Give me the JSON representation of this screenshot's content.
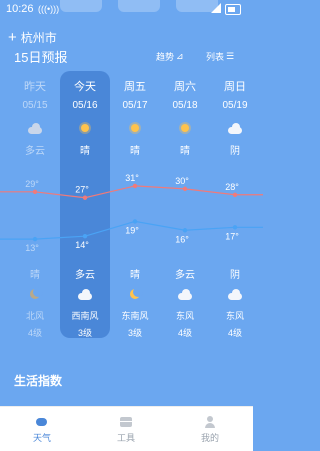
{
  "status_bar": {
    "time": "10:26",
    "wifi_text": "(((•)))"
  },
  "header": {
    "city": "杭州市",
    "forecast_title": "15日预报",
    "trend_label": "趋势",
    "list_label": "列表"
  },
  "days": [
    {
      "name": "昨天",
      "date": "05/15",
      "weather_day": "多云",
      "icon_day": "cloud-icon",
      "high": "29°",
      "low": "13°",
      "weather_night": "晴",
      "icon_night": "moon-icon",
      "wind_dir": "北风",
      "wind_level": "4级",
      "past": true
    },
    {
      "name": "今天",
      "date": "05/16",
      "weather_day": "晴",
      "icon_day": "sun-icon",
      "high": "27°",
      "low": "14°",
      "weather_night": "多云",
      "icon_night": "cloud-icon",
      "wind_dir": "西南风",
      "wind_level": "3级",
      "past": false
    },
    {
      "name": "周五",
      "date": "05/17",
      "weather_day": "晴",
      "icon_day": "sun-icon",
      "high": "31°",
      "low": "19°",
      "weather_night": "晴",
      "icon_night": "moon-icon",
      "wind_dir": "东南风",
      "wind_level": "3级",
      "past": false
    },
    {
      "name": "周六",
      "date": "05/18",
      "weather_day": "晴",
      "icon_day": "sun-icon",
      "high": "30°",
      "low": "16°",
      "weather_night": "多云",
      "icon_night": "cloud-icon",
      "wind_dir": "东风",
      "wind_level": "4级",
      "past": false
    },
    {
      "name": "周日",
      "date": "05/19",
      "weather_day": "阴",
      "icon_day": "cloud-icon",
      "high": "28°",
      "low": "17°",
      "weather_night": "阴",
      "icon_night": "cloud-icon",
      "wind_dir": "东风",
      "wind_level": "4级",
      "past": false
    }
  ],
  "chart_data": {
    "type": "line",
    "categories": [
      "05/15",
      "05/16",
      "05/17",
      "05/18",
      "05/19"
    ],
    "series": [
      {
        "values": [
          29,
          27,
          31,
          30,
          28
        ]
      },
      {
        "values": [
          13,
          14,
          19,
          16,
          17
        ]
      }
    ],
    "ylim": [
      10,
      33
    ]
  },
  "life_index_title": "生活指数",
  "bottom_nav": [
    {
      "label": "天气",
      "icon": "weather-icon",
      "active": true
    },
    {
      "label": "工具",
      "icon": "tools-icon",
      "active": false
    },
    {
      "label": "我的",
      "icon": "profile-icon",
      "active": false
    }
  ],
  "colors": {
    "background": "#6ba7f0",
    "today_highlight": "#4a87d8",
    "high_line": "#f07a7a",
    "low_line": "#4aa3f5",
    "nav_active": "#4a87d8"
  }
}
